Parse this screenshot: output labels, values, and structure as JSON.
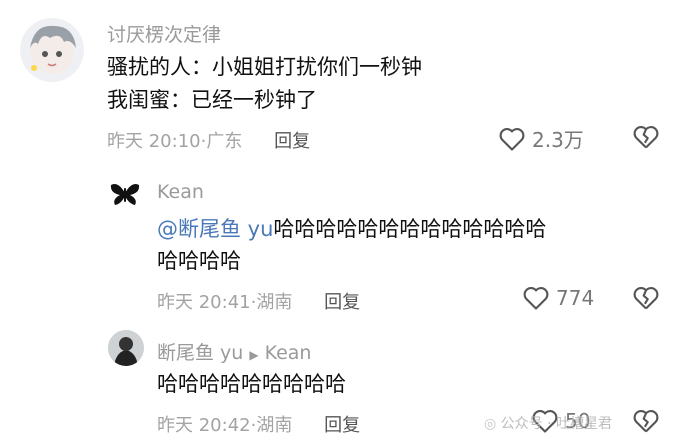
{
  "comments": [
    {
      "username": "讨厌楞次定律",
      "lines": [
        "骚扰的人：小姐姐打扰你们一秒钟",
        "我闺蜜：已经一秒钟了"
      ],
      "time": "昨天 20:10",
      "location": "广东",
      "reply_label": "回复",
      "likes": "2.3万"
    },
    {
      "username": "Kean",
      "mention": "@断尾鱼 yu",
      "text_line1": "哈哈哈哈哈哈哈哈哈哈哈哈哈",
      "text_line2": "哈哈哈哈",
      "time": "昨天 20:41",
      "location": "湖南",
      "reply_label": "回复",
      "likes": "774"
    },
    {
      "username": "断尾鱼 yu",
      "reply_to": "Kean",
      "text": "哈哈哈哈哈哈哈哈哈",
      "time": "昨天 20:42",
      "location": "湖南",
      "reply_label": "回复",
      "likes": "50"
    }
  ],
  "watermark": "公众号 · 吐槽星君",
  "colors": {
    "username": "#9a9a9a",
    "mention": "#4a78b8",
    "meta": "#a3a3a3"
  }
}
